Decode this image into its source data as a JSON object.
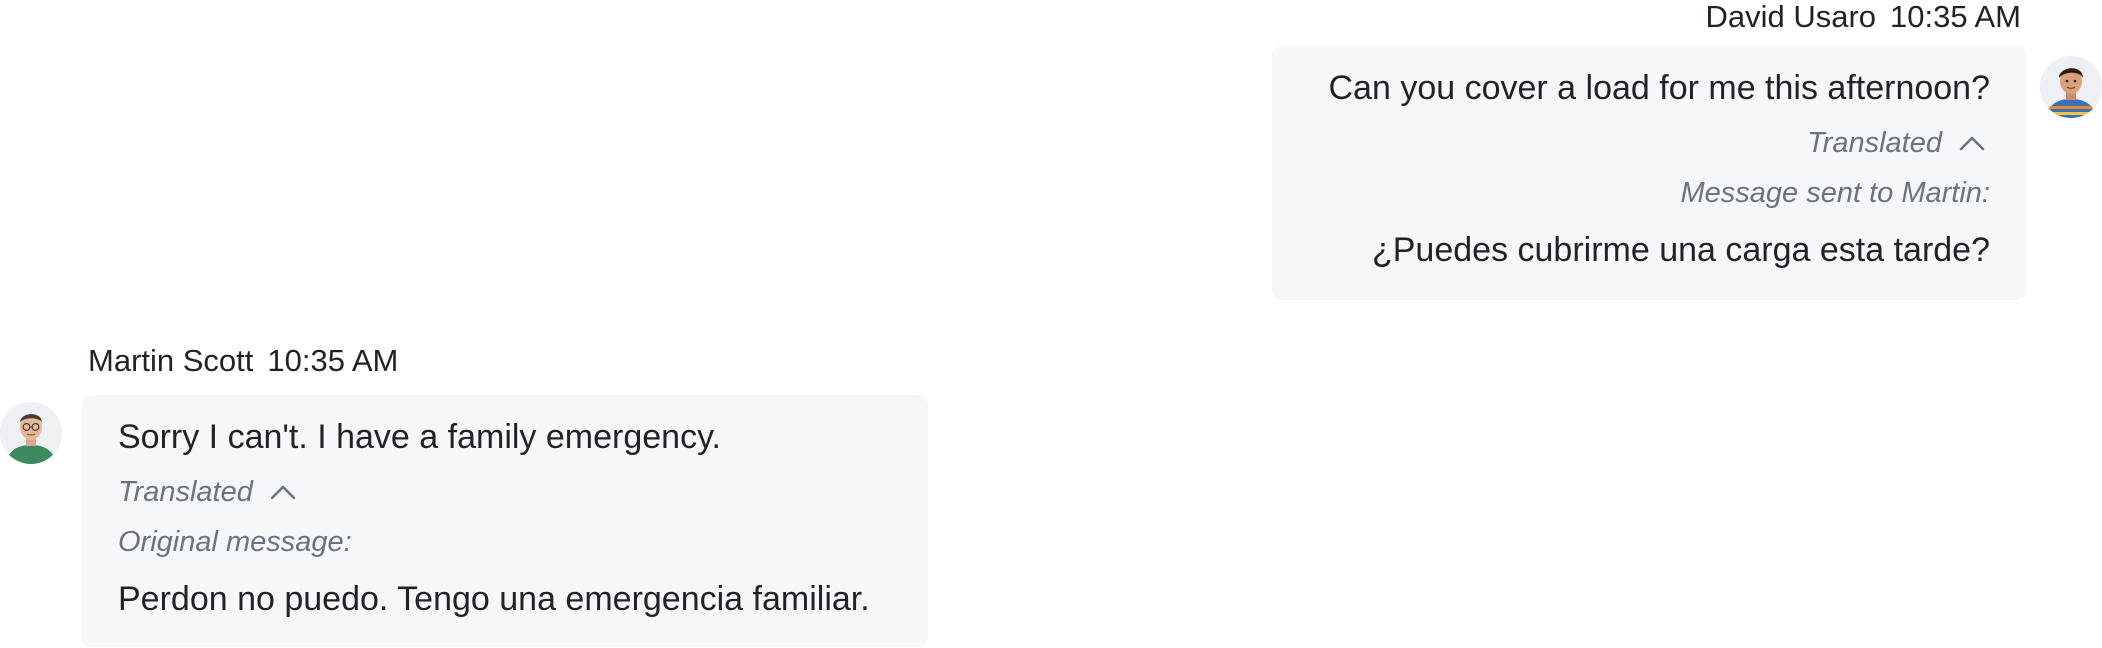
{
  "messages": {
    "outgoing": {
      "sender": "David Usaro",
      "time": "10:35 AM",
      "text": "Can you cover a load for me this afternoon?",
      "translated_label": "Translated",
      "sub_label": "Message sent to Martin:",
      "sub_text": "¿Puedes cubrirme una carga esta tarde?",
      "avatar_icon": "person-avatar-icon"
    },
    "incoming": {
      "sender": "Martin Scott",
      "time": "10:35 AM",
      "text": "Sorry I can't. I have a family emergency.",
      "translated_label": "Translated",
      "sub_label": "Original message:",
      "sub_text": "Perdon no puedo. Tengo una emergencia familiar.",
      "avatar_icon": "person-avatar-icon"
    }
  },
  "colors": {
    "bubble_background": "#f6f7f9",
    "primary_text": "#1f2328",
    "secondary_text": "#6b7280"
  }
}
